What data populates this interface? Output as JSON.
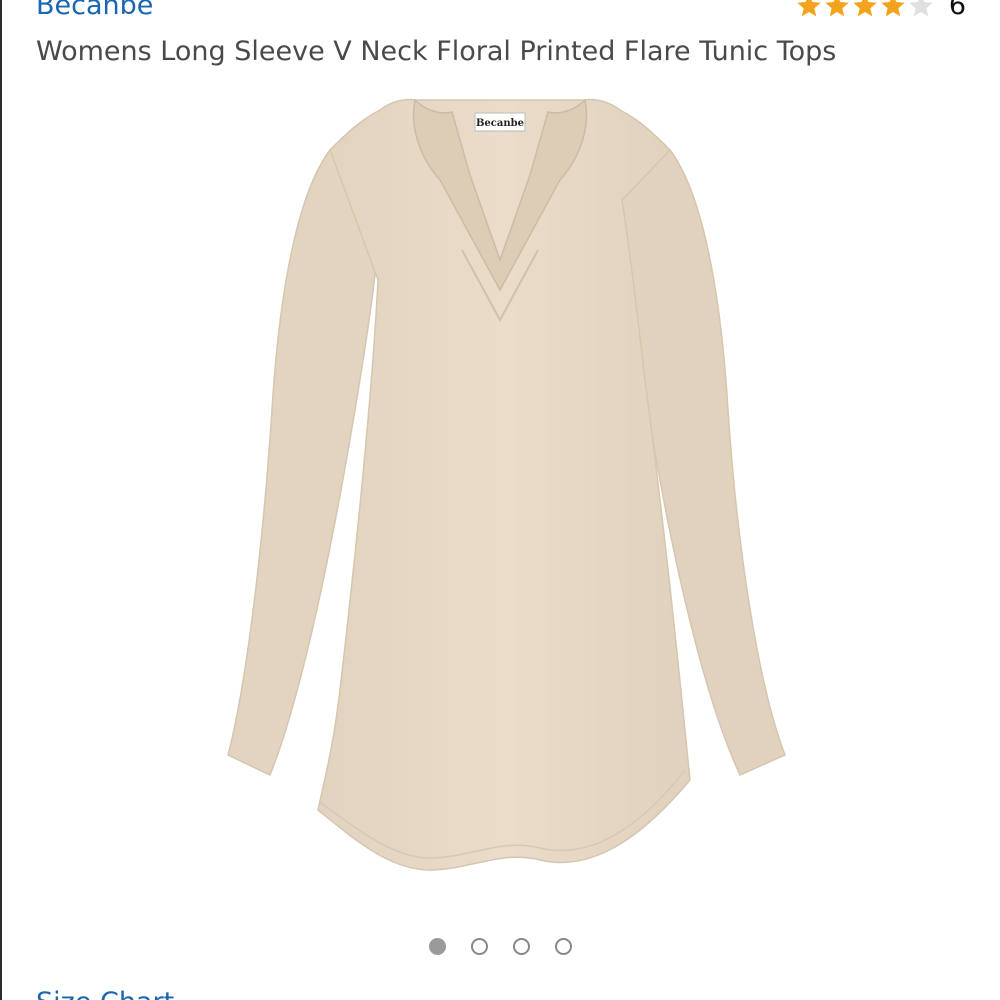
{
  "product": {
    "brand": "Becanbe",
    "title": "Womens Long Sleeve V Neck Floral Printed Flare Tunic Tops",
    "rating": {
      "stars_filled": 4,
      "stars_total": 5,
      "review_count": "6"
    },
    "image": {
      "description_icon": "tunic-top-image",
      "garment_color": "#e7d9c6",
      "label_text": "Becanbe"
    }
  },
  "carousel": {
    "total": 4,
    "active_index": 0
  },
  "links": {
    "size_chart": "Size Chart"
  },
  "colors": {
    "link": "#1a66b0",
    "star": "#f4a41c",
    "star_empty": "#e0e0e0",
    "title_text": "#4a4a4a"
  }
}
